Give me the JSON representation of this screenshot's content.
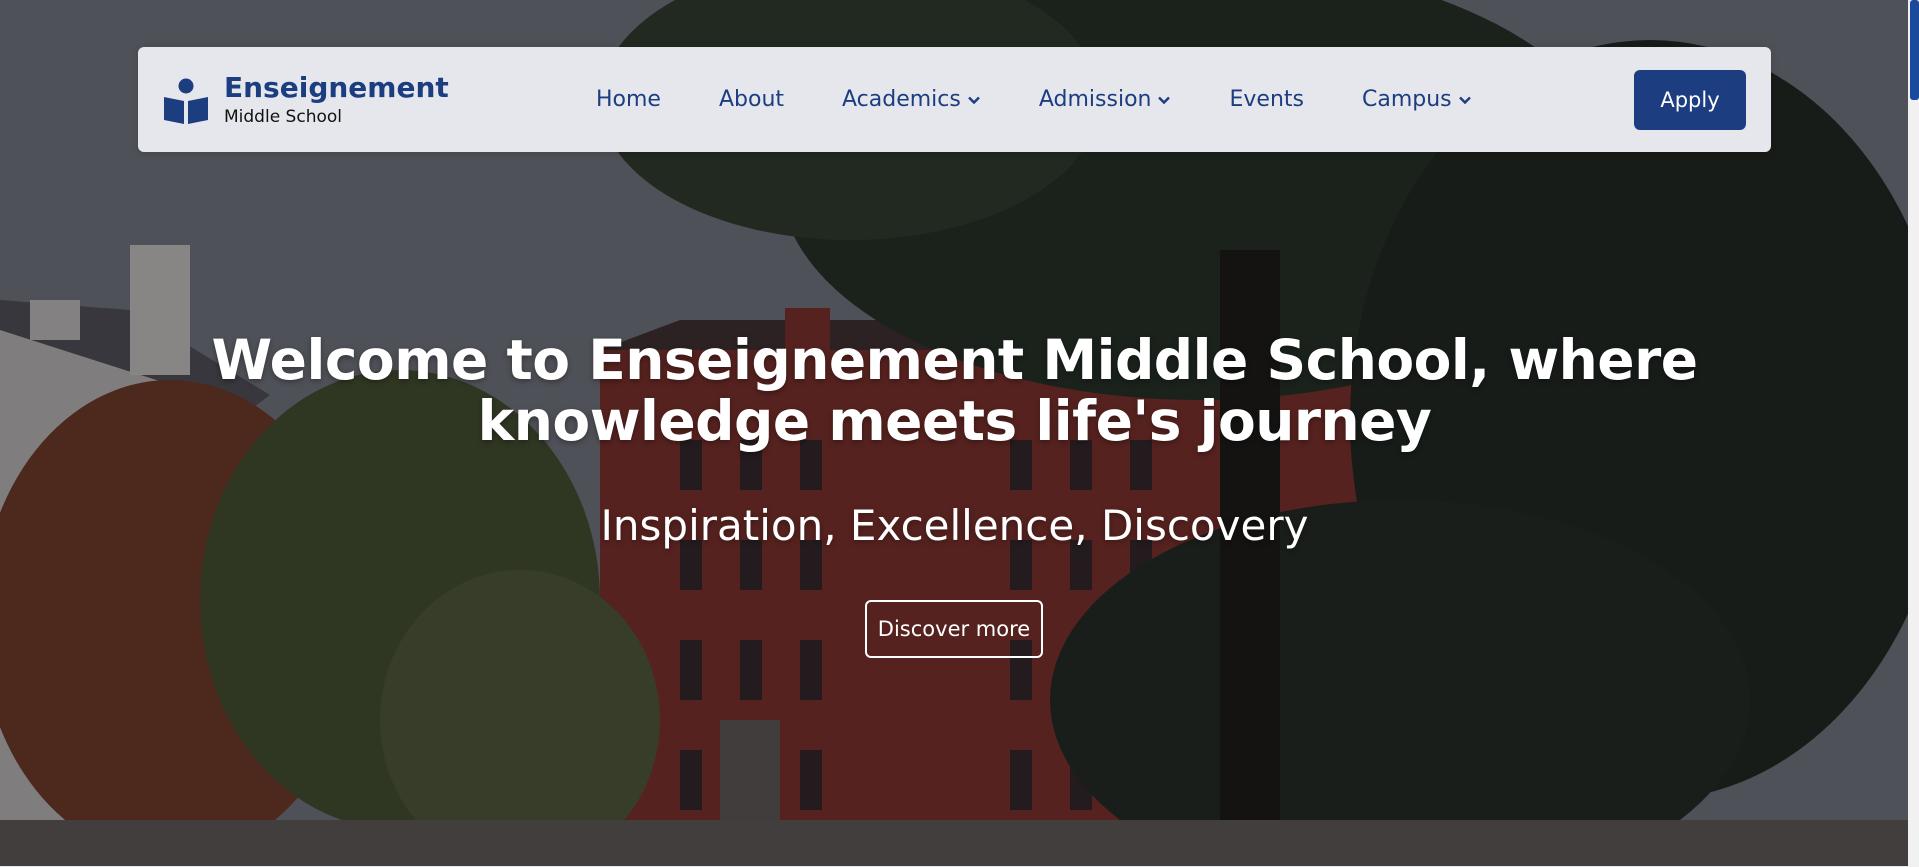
{
  "brand": {
    "name": "Enseignement",
    "subtitle": "Middle School"
  },
  "nav": {
    "items": [
      {
        "label": "Home",
        "dropdown": false
      },
      {
        "label": "About",
        "dropdown": false
      },
      {
        "label": "Academics",
        "dropdown": true
      },
      {
        "label": "Admission",
        "dropdown": true
      },
      {
        "label": "Events",
        "dropdown": false
      },
      {
        "label": "Campus",
        "dropdown": true
      }
    ],
    "apply_label": "Apply"
  },
  "hero": {
    "title": "Welcome to Enseignement Middle School, where knowledge meets life's journey",
    "subtitle": "Inspiration, Excellence, Discovery",
    "cta_label": "Discover more"
  },
  "colors": {
    "brand_blue": "#1c3d80",
    "navbar_bg": "#e6e7ec"
  }
}
